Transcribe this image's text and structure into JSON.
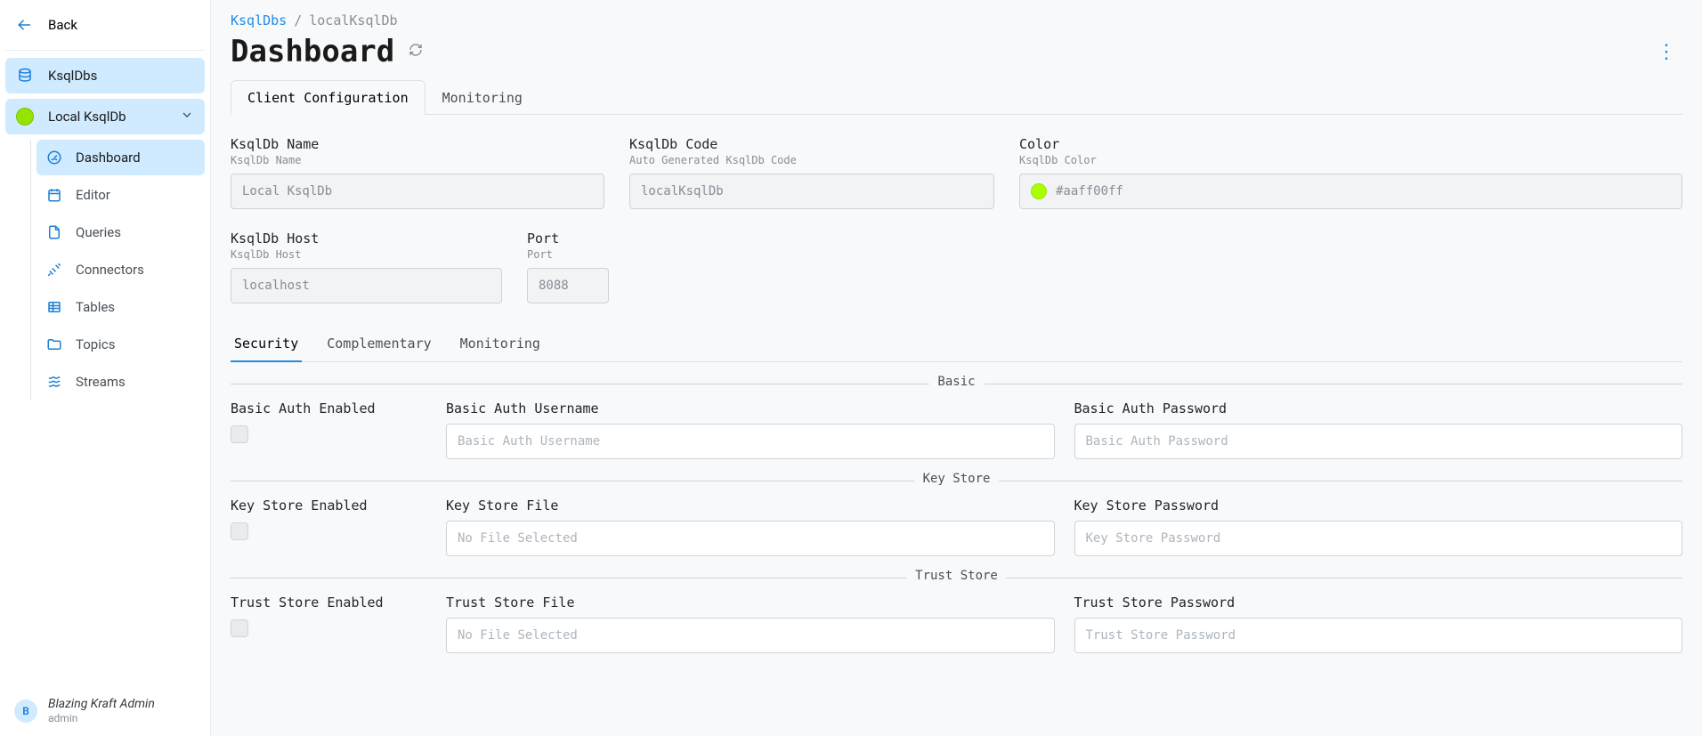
{
  "sidebar": {
    "back": "Back",
    "root": "KsqlDbs",
    "instance": "Local KsqlDb",
    "items": [
      {
        "label": "Dashboard"
      },
      {
        "label": "Editor"
      },
      {
        "label": "Queries"
      },
      {
        "label": "Connectors"
      },
      {
        "label": "Tables"
      },
      {
        "label": "Topics"
      },
      {
        "label": "Streams"
      }
    ]
  },
  "footer": {
    "avatar_letter": "B",
    "display_name": "Blazing Kraft Admin",
    "login": "admin"
  },
  "breadcrumbs": {
    "root": "KsqlDbs",
    "sep": "/",
    "leaf": "localKsqlDb"
  },
  "page_title": "Dashboard",
  "primary_tabs": {
    "client": "Client Configuration",
    "monitoring": "Monitoring"
  },
  "fields": {
    "name": {
      "label": "KsqlDb Name",
      "sub": "KsqlDb Name",
      "value": "Local KsqlDb"
    },
    "code": {
      "label": "KsqlDb Code",
      "sub": "Auto Generated KsqlDb Code",
      "value": "localKsqlDb"
    },
    "color": {
      "label": "Color",
      "sub": "KsqlDb Color",
      "value": "#aaff00ff",
      "hex": "#aaff00"
    },
    "host": {
      "label": "KsqlDb Host",
      "sub": "KsqlDb Host",
      "value": "localhost"
    },
    "port": {
      "label": "Port",
      "sub": "Port",
      "value": "8088"
    }
  },
  "sub_tabs": {
    "security": "Security",
    "complementary": "Complementary",
    "monitoring": "Monitoring"
  },
  "groups": {
    "basic": {
      "title": "Basic",
      "enabled_label": "Basic Auth Enabled",
      "user_label": "Basic Auth Username",
      "user_placeholder": "Basic Auth Username",
      "pass_label": "Basic Auth Password",
      "pass_placeholder": "Basic Auth Password"
    },
    "keystore": {
      "title": "Key Store",
      "enabled_label": "Key Store Enabled",
      "file_label": "Key Store File",
      "file_placeholder": "No File Selected",
      "pass_label": "Key Store Password",
      "pass_placeholder": "Key Store Password"
    },
    "truststore": {
      "title": "Trust Store",
      "enabled_label": "Trust Store Enabled",
      "file_label": "Trust Store File",
      "file_placeholder": "No File Selected",
      "pass_label": "Trust Store Password",
      "pass_placeholder": "Trust Store Password"
    }
  }
}
